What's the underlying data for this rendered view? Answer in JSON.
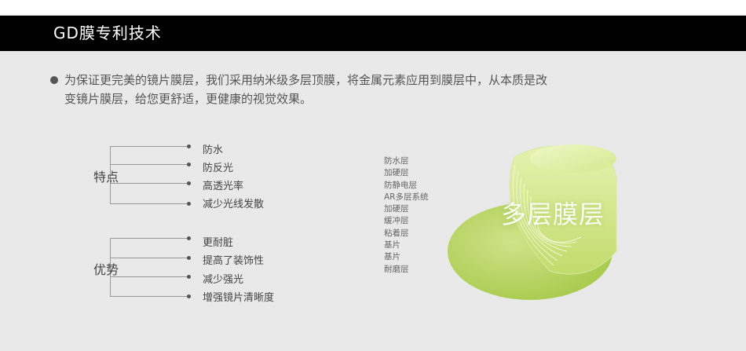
{
  "header": {
    "title": "GD膜专利技术"
  },
  "intro": {
    "line1": "为保证更完美的镜片膜层，我们采用纳米级多层顶膜，将金属元素应用到膜层中，从本质是改",
    "line2": "变镜片膜层，给您更舒适，更健康的视觉效果。"
  },
  "features": {
    "label": "特点",
    "items": [
      "防水",
      "防反光",
      "高透光率",
      "减少光线发散"
    ]
  },
  "advantages": {
    "label": "优势",
    "items": [
      "更耐脏",
      "提高了装饰性",
      "减少强光",
      "增强镜片清晰度"
    ]
  },
  "layers": [
    "防水层",
    "加硬层",
    "防静电层",
    "AR多层系统",
    "加硬层",
    "缓冲层",
    "粘着层",
    "基片",
    "基片",
    "耐磨层"
  ],
  "graphic": {
    "label": "多层膜层",
    "colors": {
      "light": "#e4f0a8",
      "main": "#b5d35a",
      "edge": "#c9e07e"
    }
  }
}
